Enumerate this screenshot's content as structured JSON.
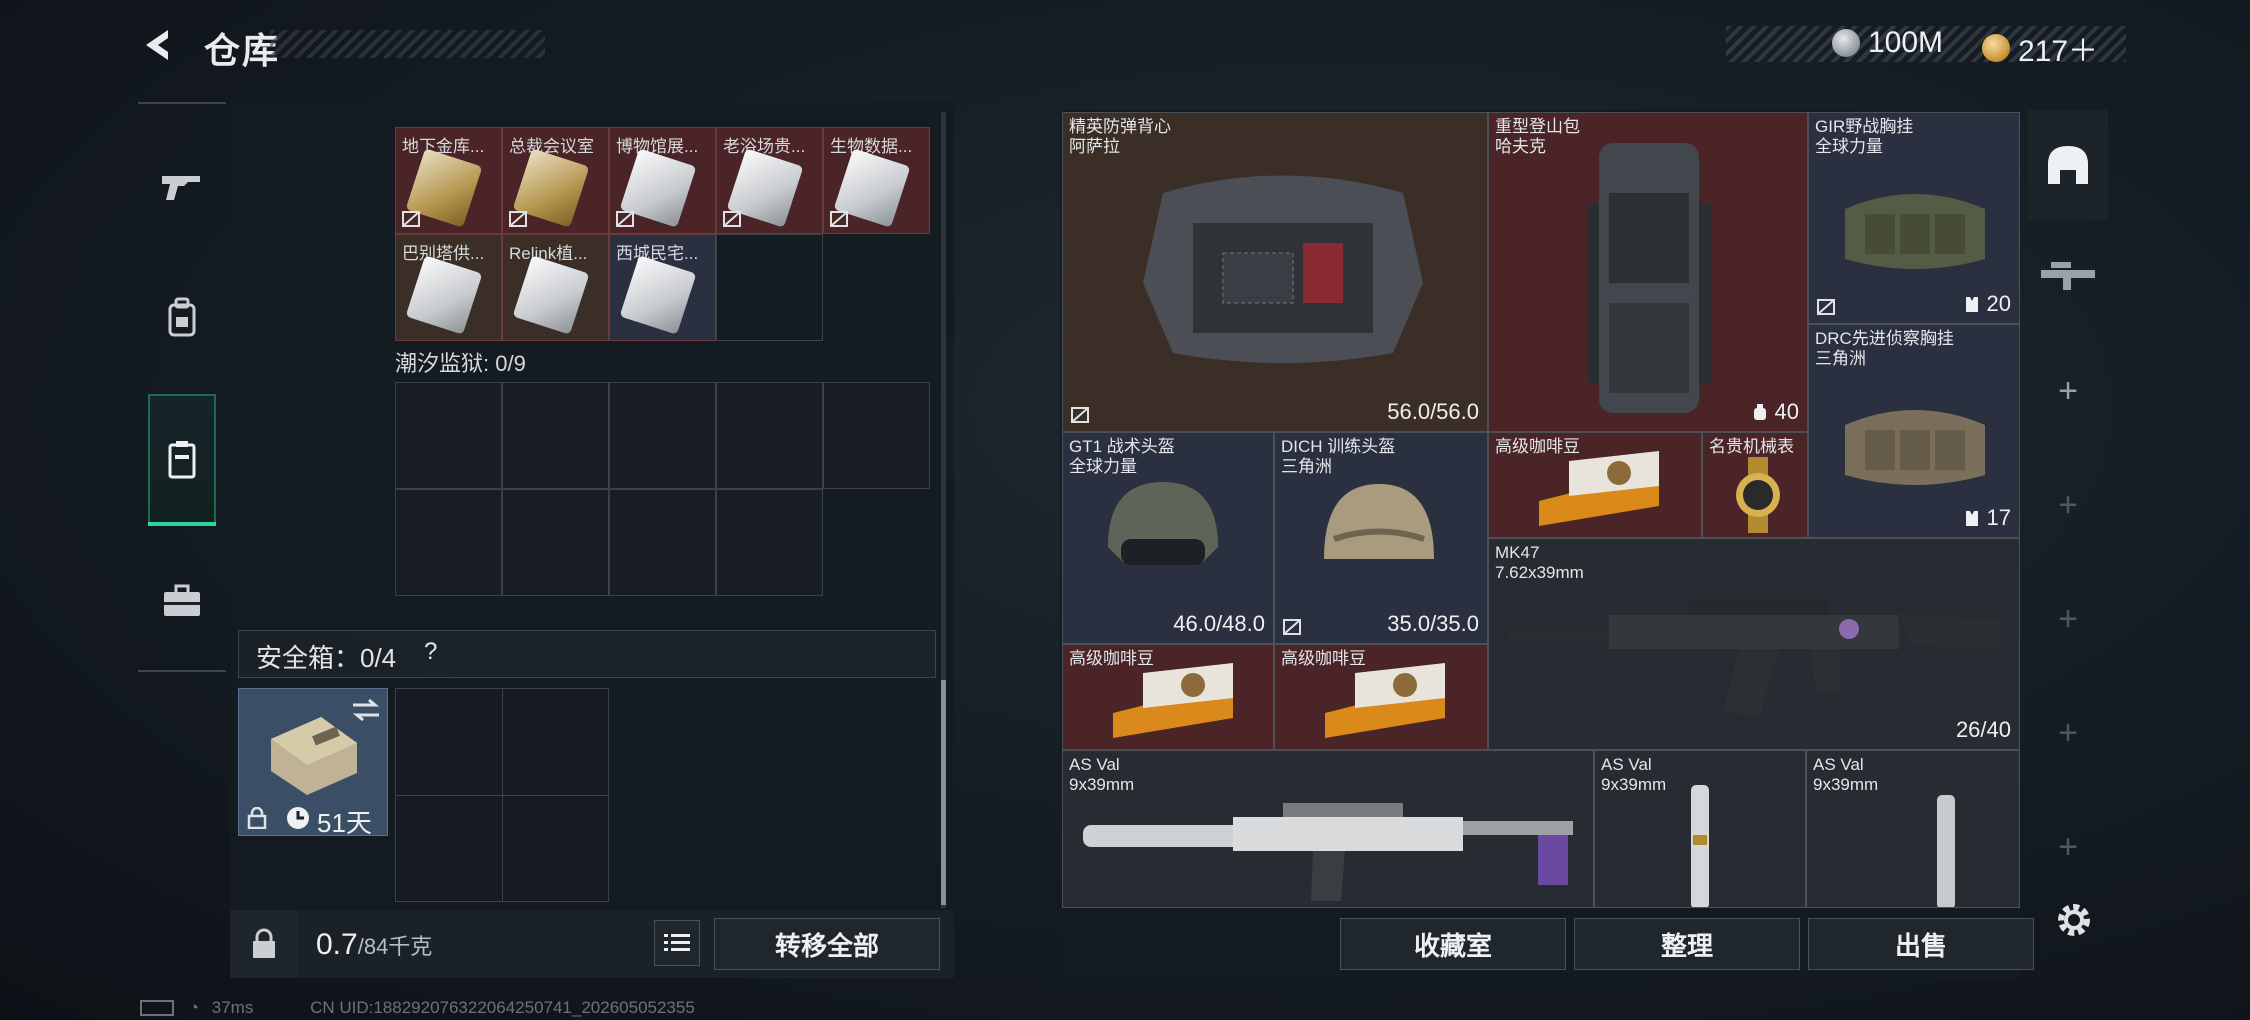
{
  "header": {
    "title": "仓库"
  },
  "currency": [
    {
      "icon": "silver-coin-icon",
      "value": "100M"
    },
    {
      "icon": "gold-coin-icon",
      "value": "217＋"
    }
  ],
  "left_nav": [
    "gun-icon",
    "backpack-icon",
    "storage-case-icon",
    "briefcase-icon"
  ],
  "keycards": [
    {
      "label": "地下金库...",
      "style": "gold",
      "bg": "#4a2427"
    },
    {
      "label": "总裁会议室",
      "style": "gold",
      "bg": "#4a2427"
    },
    {
      "label": "博物馆展...",
      "style": "silver",
      "bg": "#4a2427"
    },
    {
      "label": "老浴场贵...",
      "style": "silver",
      "bg": "#4a2427"
    },
    {
      "label": "生物数据...",
      "style": "silver",
      "bg": "#4a2427"
    },
    {
      "label": "巴别塔供...",
      "style": "silver",
      "bg": "#3a2e27"
    },
    {
      "label": "Relink植...",
      "style": "silver",
      "bg": "#3a2e27"
    },
    {
      "label": "西城民宅...",
      "style": "silver",
      "bg": "#2a3040"
    }
  ],
  "section2": {
    "label": "潮汐监狱: 0/9"
  },
  "safe_box": {
    "label": "安全箱：0/4",
    "help": "?",
    "days": "51天"
  },
  "bottom_left": {
    "weight": "0.7",
    "max_weight": "/84千克",
    "transfer_all": "转移全部"
  },
  "items": {
    "vest": {
      "name": "精英防弹背心",
      "brand": "阿萨拉",
      "durability": "56.0/56.0"
    },
    "backpack": {
      "name": "重型登山包",
      "brand": "哈夫克",
      "count": "40"
    },
    "chest1": {
      "name": "GIR野战胸挂",
      "brand": "全球力量",
      "count": "20"
    },
    "chest2": {
      "name": "DRC先进侦察胸挂",
      "brand": "三角洲",
      "count": "17"
    },
    "helmet1": {
      "name": "GT1 战术头盔",
      "brand": "全球力量",
      "durability": "46.0/48.0"
    },
    "helmet2": {
      "name": "DICH 训练头盔",
      "brand": "三角洲",
      "durability": "35.0/35.0"
    },
    "coffee1": {
      "name": "高级咖啡豆"
    },
    "watch": {
      "name": "名贵机械表"
    },
    "mk47": {
      "name": "MK47",
      "caliber": "7.62x39mm",
      "ammo": "26/40"
    },
    "coffee2": {
      "name": "高级咖啡豆"
    },
    "coffee3": {
      "name": "高级咖啡豆"
    },
    "asval1": {
      "name": "AS Val",
      "caliber": "9x39mm"
    },
    "asval2": {
      "name": "AS Val",
      "caliber": "9x39mm"
    },
    "asval3": {
      "name": "AS Val",
      "caliber": "9x39mm"
    }
  },
  "bottom_right": {
    "collection": "收藏室",
    "sort": "整理",
    "sell": "出售"
  },
  "right_nav": [
    "helmet-icon",
    "rifle-icon",
    "plus-icon",
    "plus-icon",
    "plus-icon",
    "plus-icon",
    "plus-icon"
  ],
  "footer": {
    "ping": "37ms",
    "uid": "CN UID:188292076322064250741_202605052355"
  }
}
